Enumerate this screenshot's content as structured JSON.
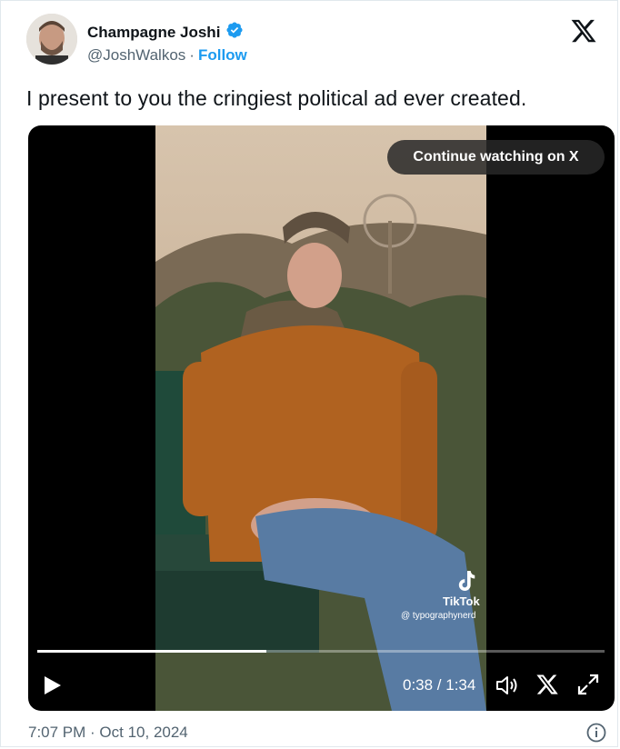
{
  "author": {
    "name": "Champagne Joshi",
    "handle": "@JoshWalkos",
    "separator": "·",
    "follow_label": "Follow"
  },
  "tweet": {
    "text": "I present to you the cringiest political ad ever created.",
    "timestamp": "7:07 PM · Oct 10, 2024"
  },
  "video": {
    "continue_label": "Continue watching on X",
    "current_time": "0:38",
    "duration": "1:34",
    "time_display": "0:38 / 1:34",
    "progress_fraction": 0.404,
    "watermark_brand": "TikTok",
    "watermark_user": "@ typographynerd"
  },
  "colors": {
    "accent": "#1d9bf0",
    "text": "#0f1419",
    "muted": "#536471"
  },
  "icons": [
    "verified-badge-icon",
    "x-logo-icon",
    "play-icon",
    "volume-icon",
    "x-icon",
    "fullscreen-icon",
    "info-icon",
    "tiktok-logo-icon"
  ]
}
